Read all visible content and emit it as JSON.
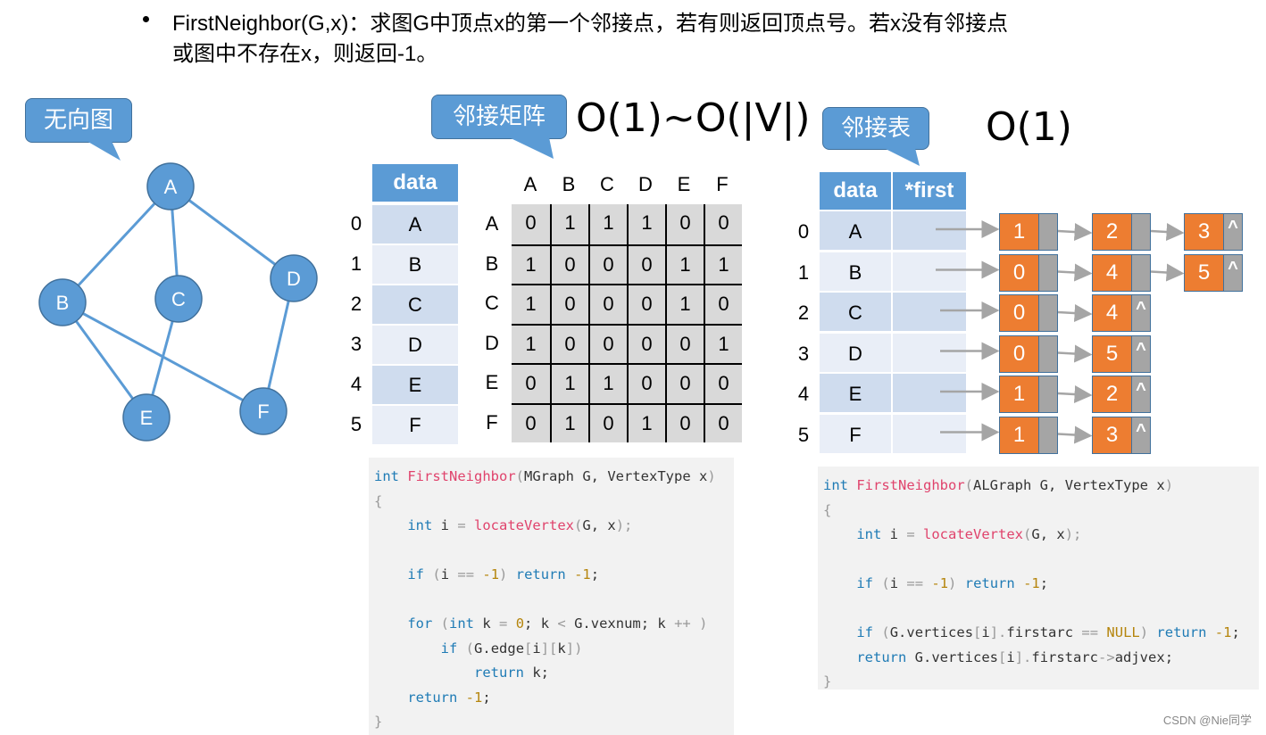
{
  "heading": {
    "line1": "FirstNeighbor(G,x)：求图G中顶点x的第一个邻接点，若有则返回顶点号。若x没有邻接点",
    "line2": "或图中不存在x，则返回-1。"
  },
  "graph": {
    "callout": "无向图",
    "vertices": [
      "A",
      "B",
      "C",
      "D",
      "E",
      "F"
    ],
    "edges": [
      [
        "A",
        "B"
      ],
      [
        "A",
        "C"
      ],
      [
        "A",
        "D"
      ],
      [
        "B",
        "E"
      ],
      [
        "B",
        "F"
      ],
      [
        "C",
        "E"
      ],
      [
        "D",
        "F"
      ]
    ],
    "colors": {
      "node": "#5b9bd5",
      "edge": "#5b9bd5",
      "border": "#41719c"
    }
  },
  "matrix": {
    "callout": "邻接矩阵",
    "complexity": "O(1)~O(|V|)",
    "data_header": "data",
    "indices": [
      "0",
      "1",
      "2",
      "3",
      "4",
      "5"
    ],
    "data": [
      "A",
      "B",
      "C",
      "D",
      "E",
      "F"
    ],
    "col_labels": [
      "A",
      "B",
      "C",
      "D",
      "E",
      "F"
    ],
    "row_labels": [
      "A",
      "B",
      "C",
      "D",
      "E",
      "F"
    ],
    "rows": [
      [
        "0",
        "1",
        "1",
        "1",
        "0",
        "0"
      ],
      [
        "1",
        "0",
        "0",
        "0",
        "1",
        "1"
      ],
      [
        "1",
        "0",
        "0",
        "0",
        "1",
        "0"
      ],
      [
        "1",
        "0",
        "0",
        "0",
        "0",
        "1"
      ],
      [
        "0",
        "1",
        "1",
        "0",
        "0",
        "0"
      ],
      [
        "0",
        "1",
        "0",
        "1",
        "0",
        "0"
      ]
    ]
  },
  "adjlist": {
    "callout": "邻接表",
    "complexity": "O(1)",
    "data_header": "data",
    "first_header": "*first",
    "indices": [
      "0",
      "1",
      "2",
      "3",
      "4",
      "5"
    ],
    "data": [
      "A",
      "B",
      "C",
      "D",
      "E",
      "F"
    ],
    "null_symbol": "^",
    "lists": [
      [
        "1",
        "2",
        "3"
      ],
      [
        "0",
        "4",
        "5"
      ],
      [
        "0",
        "4"
      ],
      [
        "0",
        "5"
      ],
      [
        "1",
        "2"
      ],
      [
        "1",
        "3"
      ]
    ],
    "colors": {
      "node_value": "#ed7d31",
      "node_pointer": "#a5a5a5"
    }
  },
  "code_matrix": {
    "lines": [
      "int FirstNeighbor(MGraph G, VertexType x)",
      "{",
      "    int i = locateVertex(G, x);",
      "",
      "    if (i == -1) return -1;",
      "",
      "    for (int k = 0; k < G.vexnum; k ++ )",
      "        if (G.edge[i][k])",
      "            return k;",
      "    return -1;",
      "}"
    ]
  },
  "code_list": {
    "lines": [
      "int FirstNeighbor(ALGraph G, VertexType x)",
      "{",
      "    int i = locateVertex(G, x);",
      "",
      "    if (i == -1) return -1;",
      "",
      "    if (G.vertices[i].firstarc == NULL) return -1;",
      "    return G.vertices[i].firstarc->adjvex;",
      "}"
    ]
  },
  "footer": "CSDN @Nie同学"
}
